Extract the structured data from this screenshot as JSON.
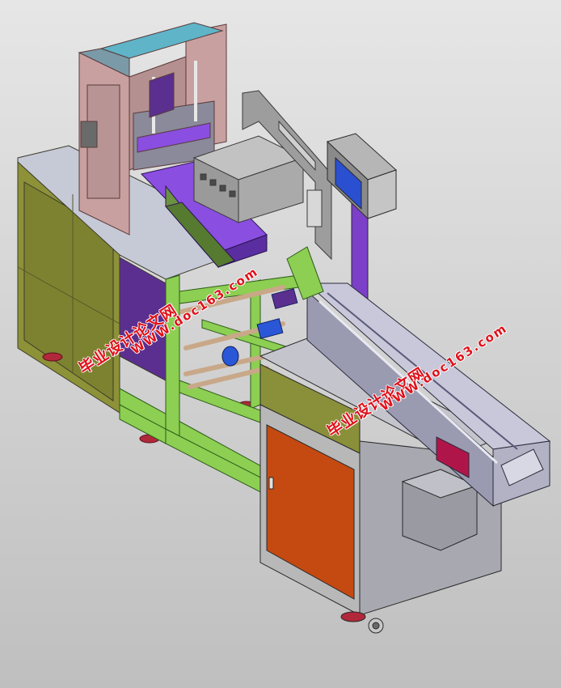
{
  "watermarks": [
    {
      "cn": "毕业设计论文网",
      "url": "WWW.doc163.com"
    },
    {
      "cn": "毕业设计论文网",
      "url": "WWW.doc163.com"
    }
  ],
  "colors": {
    "background": "#d4d4d4",
    "olive_panel": "#8a8f3a",
    "frame_green": "#86c44c",
    "purple": "#7c3fc4",
    "pink": "#c79b9b",
    "gray_steel": "#a8a8b0",
    "orange_door": "#c84a10",
    "screen_blue": "#2a4fd0"
  }
}
